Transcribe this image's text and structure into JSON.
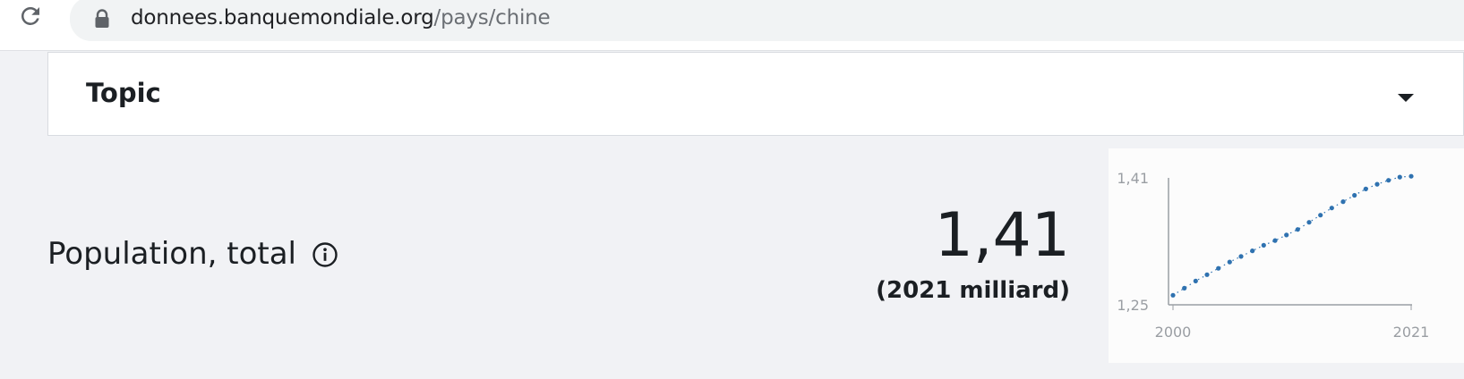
{
  "browser": {
    "url_host": "donnees.banquemondiale.org",
    "url_path": "/pays/chine"
  },
  "topic": {
    "label": "Topic"
  },
  "indicator": {
    "name": "Population, total",
    "value": "1,41",
    "subtitle": "(2021 milliard)"
  },
  "colors": {
    "background": "#f1f2f5",
    "series": "#2f72b0"
  },
  "icons": {
    "reload": "reload-icon",
    "lock": "lock-icon",
    "caret": "caret-down-icon",
    "info": "info-icon"
  },
  "chart_data": {
    "type": "line",
    "style": "dotted",
    "x": [
      2000,
      2001,
      2002,
      2003,
      2004,
      2005,
      2006,
      2007,
      2008,
      2009,
      2010,
      2011,
      2012,
      2013,
      2014,
      2015,
      2016,
      2017,
      2018,
      2019,
      2020,
      2021
    ],
    "series": [
      {
        "values": [
          1.262,
          1.271,
          1.28,
          1.288,
          1.296,
          1.304,
          1.311,
          1.318,
          1.325,
          1.331,
          1.338,
          1.345,
          1.354,
          1.363,
          1.372,
          1.38,
          1.388,
          1.396,
          1.402,
          1.407,
          1.411,
          1.412
        ]
      }
    ],
    "ylim": [
      1.25,
      1.41
    ],
    "xlim": [
      2000,
      2021
    ],
    "ytick_labels": [
      "1,25",
      "1,41"
    ],
    "xtick_labels": [
      "2000",
      "2021"
    ],
    "grid": false
  }
}
